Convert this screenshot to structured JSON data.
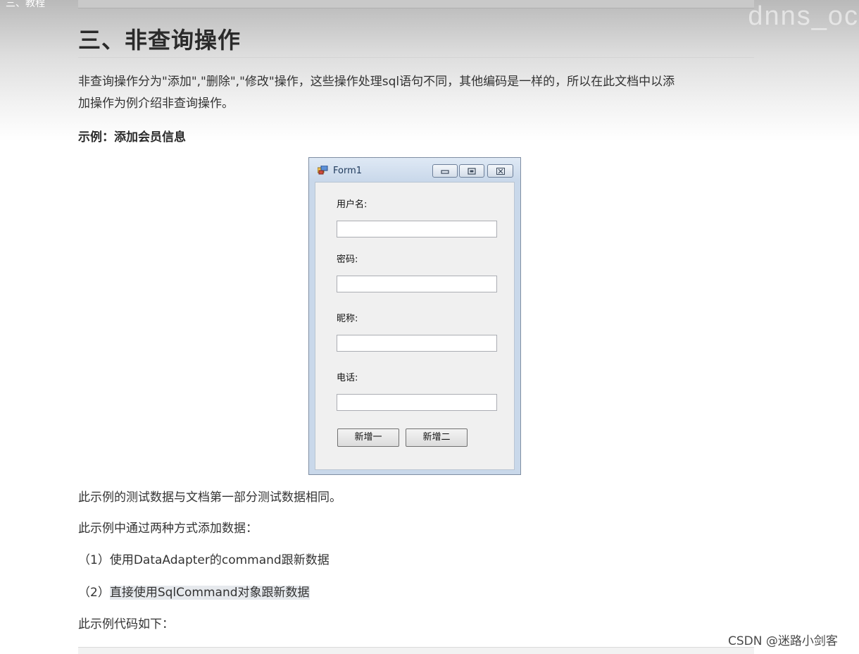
{
  "page": {
    "top_left_text": "三、教程",
    "watermark_top": "dnns_oc",
    "heading": "三、非查询操作",
    "intro_line1": "非查询操作分为\"添加\",\"删除\",\"修改\"操作，这些操作处理sql语句不同，其他编码是一样的，所以在此文档中以添",
    "intro_line2": "加操作为例介绍非查询操作。",
    "example_title": "示例：添加会员信息",
    "after_para1": "此示例的测试数据与文档第一部分测试数据相同。",
    "after_para2": "此示例中通过两种方式添加数据：",
    "item1": "（1）使用DataAdapter的command跟新数据",
    "item2_prefix": "（2）",
    "item2_highlight": "直接使用SqlCommand对象跟新数据",
    "after_para3": "此示例代码如下：",
    "credit": "CSDN @迷路小剑客"
  },
  "form": {
    "title": "Form1",
    "app_icon": "windows-form-icon",
    "minimize_icon": "minimize-icon",
    "maximize_icon": "maximize-icon",
    "close_icon": "close-icon",
    "labels": [
      "用户名:",
      "密码:",
      "昵称:",
      "电话:"
    ],
    "fields": [
      "",
      "",
      "",
      ""
    ],
    "button1": "新增一",
    "button2": "新增二"
  }
}
